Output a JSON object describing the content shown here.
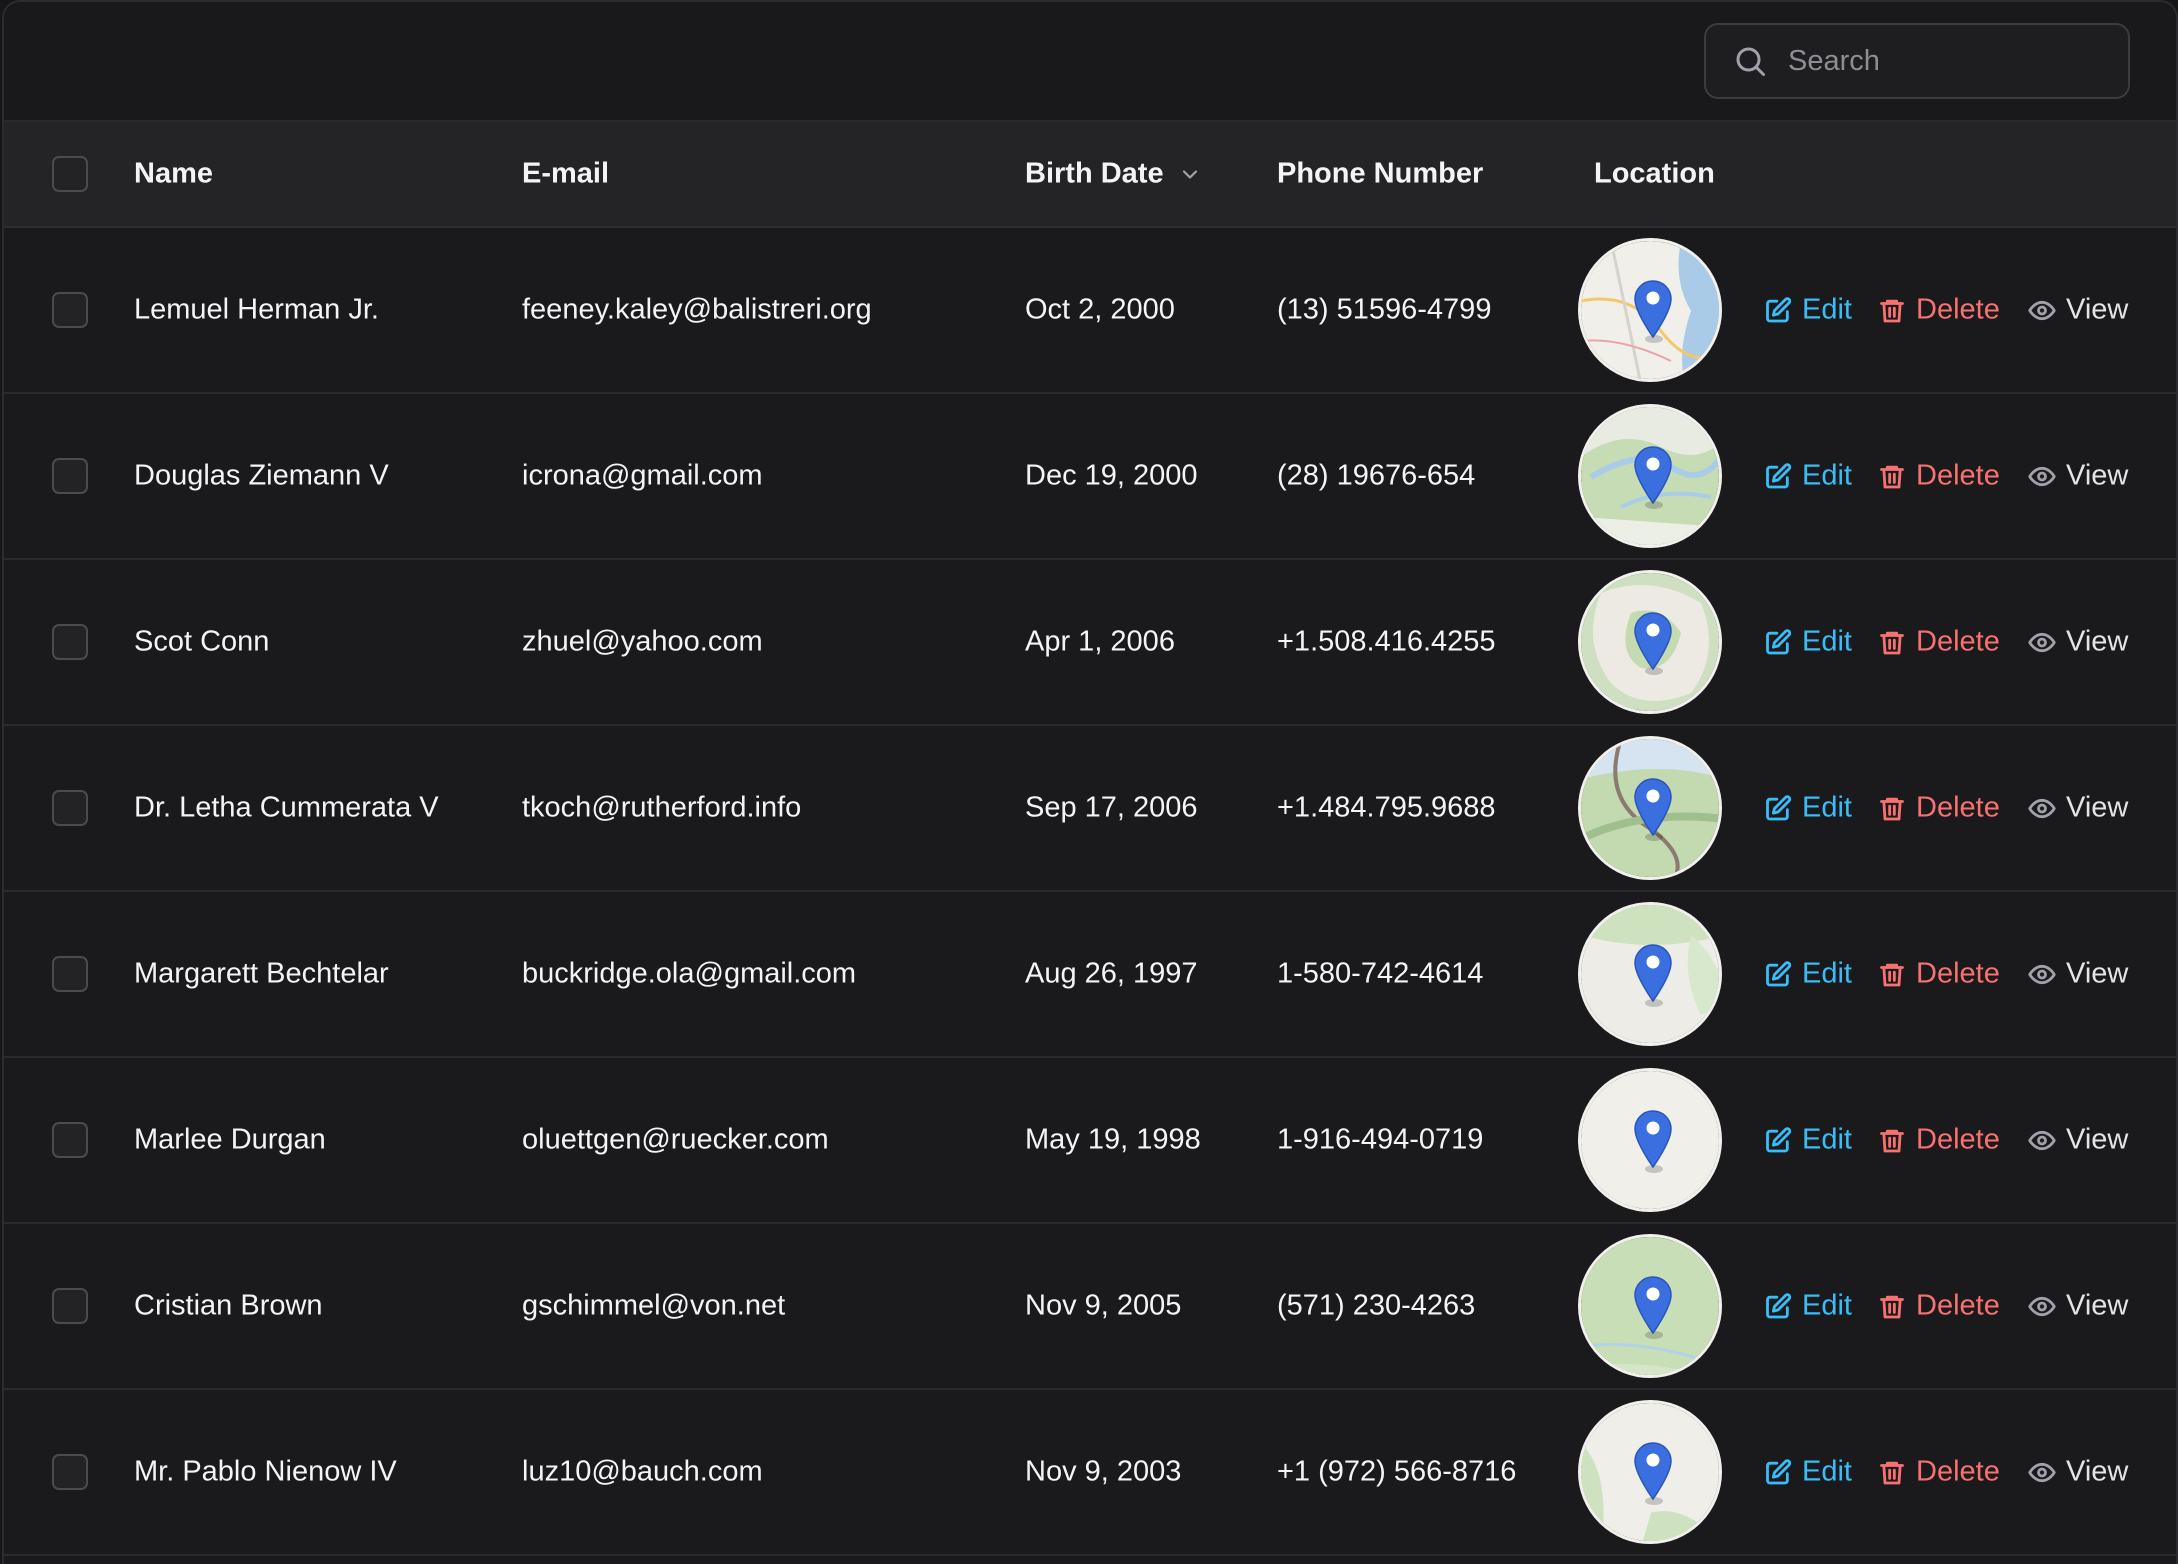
{
  "search": {
    "placeholder": "Search"
  },
  "columns": {
    "name": "Name",
    "email": "E-mail",
    "birth": "Birth Date",
    "phone": "Phone Number",
    "location": "Location"
  },
  "actions": {
    "edit": "Edit",
    "delete": "Delete",
    "view": "View"
  },
  "colors": {
    "edit": "#38bdf8",
    "delete": "#f87171",
    "view": "#e4e4e7",
    "pin": "#3b6fe0"
  },
  "rows": [
    {
      "name": "Lemuel Herman Jr.",
      "email": "feeney.kaley@balistreri.org",
      "birth": "Oct 2, 2000",
      "phone": "(13) 51596-4799"
    },
    {
      "name": "Douglas Ziemann V",
      "email": "icrona@gmail.com",
      "birth": "Dec 19, 2000",
      "phone": "(28) 19676-654"
    },
    {
      "name": "Scot Conn",
      "email": "zhuel@yahoo.com",
      "birth": "Apr 1, 2006",
      "phone": "+1.508.416.4255"
    },
    {
      "name": "Dr. Letha Cummerata V",
      "email": "tkoch@rutherford.info",
      "birth": "Sep 17, 2006",
      "phone": "+1.484.795.9688"
    },
    {
      "name": "Margarett Bechtelar",
      "email": "buckridge.ola@gmail.com",
      "birth": "Aug 26, 1997",
      "phone": "1-580-742-4614"
    },
    {
      "name": "Marlee Durgan",
      "email": "oluettgen@ruecker.com",
      "birth": "May 19, 1998",
      "phone": "1-916-494-0719"
    },
    {
      "name": "Cristian Brown",
      "email": "gschimmel@von.net",
      "birth": "Nov 9, 2005",
      "phone": "(571) 230-4263"
    },
    {
      "name": "Mr. Pablo Nienow IV",
      "email": "luz10@bauch.com",
      "birth": "Nov 9, 2003",
      "phone": "+1 (972) 566-8716"
    }
  ]
}
